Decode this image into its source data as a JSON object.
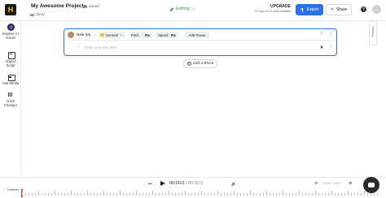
{
  "header": {
    "logo_letter": "H",
    "project_title": "My Awesome Project",
    "saved_status": "Saved",
    "breadcrumb": "Story",
    "mode": "Editing",
    "upgrade_title": "UPGRADE",
    "upgrade_sub": "10 mins of 10 mins available",
    "export_label": "Export",
    "share_label": "Share",
    "help_glyph": "?"
  },
  "sidebar": {
    "items": [
      {
        "label_1": "Explore AI",
        "label_2": "Voices"
      },
      {
        "label_1": "Import",
        "label_2": "Script"
      },
      {
        "label_1": "Add Media",
        "label_2": ""
      },
      {
        "label_1": "Voice",
        "label_2": "Changer"
      }
    ]
  },
  "right_tab": {
    "label": "Preview"
  },
  "block": {
    "voice_name": "Nala (M)",
    "style_label": "General",
    "pitch_label": "Pitch",
    "pitch_value": "0%",
    "speed_label": "Speed",
    "speed_value": "0%",
    "pause_label": "Add Pause",
    "row_number": "1",
    "text_placeholder": "Enter your text here"
  },
  "add_block_label": "Add a Block",
  "player": {
    "current_time": "00:00.0",
    "total_time": "00:00.0",
    "zoom_label": "Zoom: 100%",
    "timeline_label": "Timeline"
  },
  "colors": {
    "accent": "#2f6fe8",
    "editing_green": "#2e9e48",
    "playhead_red": "#e53935"
  }
}
